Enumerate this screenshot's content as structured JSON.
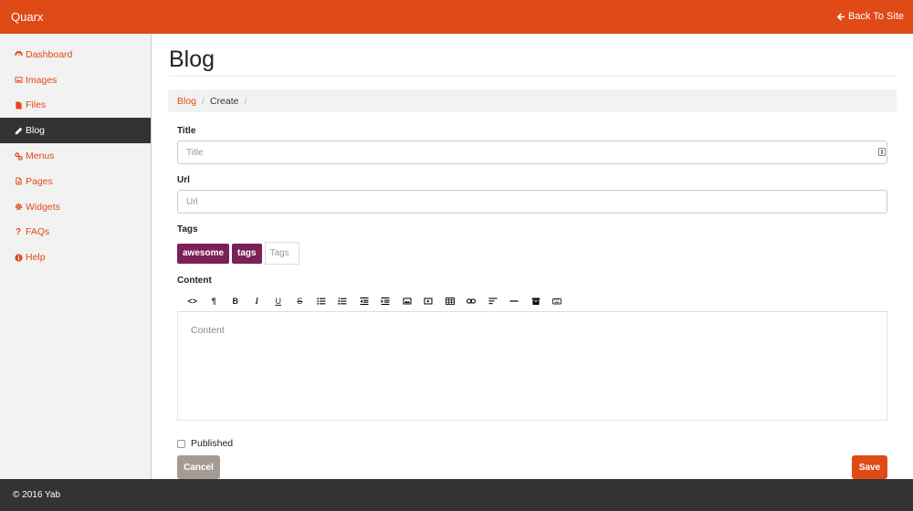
{
  "header": {
    "brand": "Quarx",
    "back_link": "Back To Site"
  },
  "sidebar": {
    "items": [
      {
        "label": "Dashboard",
        "icon": "dashboard-icon"
      },
      {
        "label": "Images",
        "icon": "image-icon"
      },
      {
        "label": "Files",
        "icon": "file-icon"
      },
      {
        "label": "Blog",
        "icon": "pencil-icon",
        "active": true
      },
      {
        "label": "Menus",
        "icon": "link-icon"
      },
      {
        "label": "Pages",
        "icon": "page-icon"
      },
      {
        "label": "Widgets",
        "icon": "gear-icon"
      },
      {
        "label": "FAQs",
        "icon": "question-icon"
      },
      {
        "label": "Help",
        "icon": "info-icon"
      }
    ]
  },
  "main": {
    "title": "Blog",
    "breadcrumb": {
      "link": "Blog",
      "current": "Create"
    },
    "form": {
      "title_label": "Title",
      "title_placeholder": "Title",
      "url_label": "Url",
      "url_placeholder": "Url",
      "tags_label": "Tags",
      "tags": [
        "awesome",
        "tags"
      ],
      "tags_placeholder": "Tags",
      "content_label": "Content",
      "content_placeholder": "Content",
      "published_label": "Published",
      "cancel_label": "Cancel",
      "save_label": "Save"
    },
    "toolbar_buttons": [
      "<>",
      "¶",
      "B",
      "I",
      "U",
      "S"
    ]
  },
  "footer": {
    "text": "© 2016 Yab"
  },
  "colors": {
    "accent": "#e04a17",
    "tag": "#7b2155",
    "dark": "#333333",
    "cancel": "#a59b93"
  }
}
